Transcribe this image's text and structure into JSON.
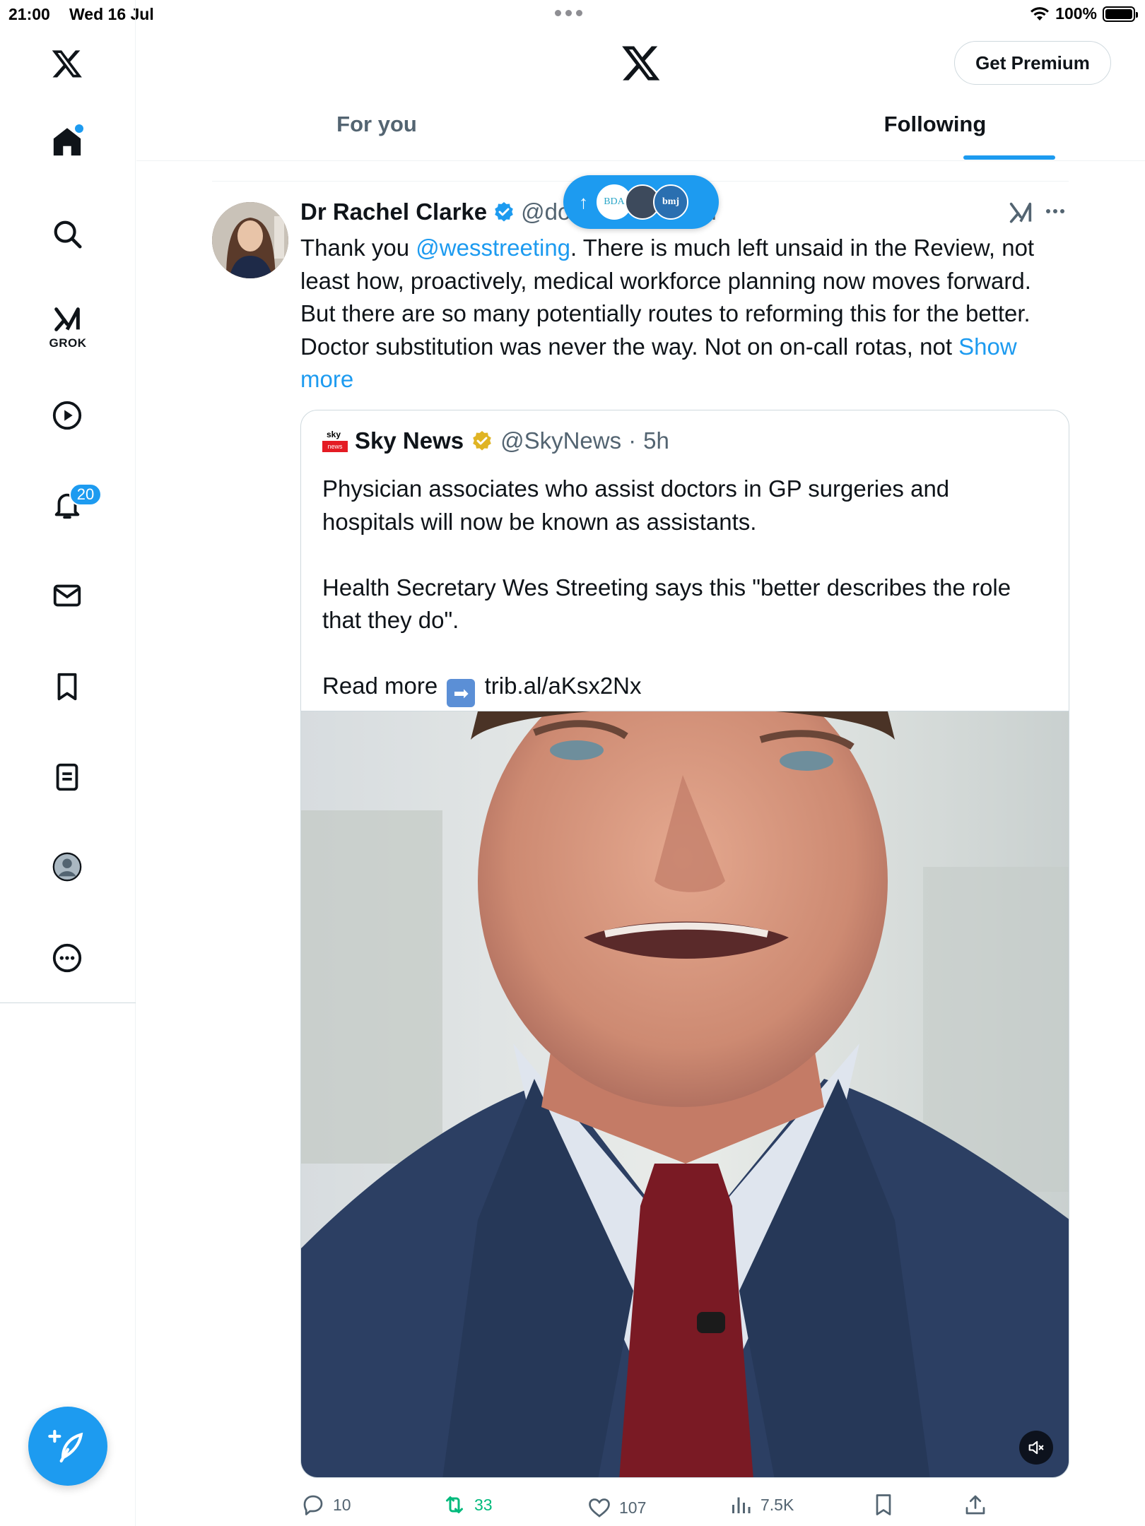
{
  "status_bar": {
    "time": "21:00",
    "date": "Wed 16 Jul",
    "battery": "100%",
    "battery_level": 1.0
  },
  "sidebar": {
    "items": [
      {
        "name": "x-logo-icon"
      },
      {
        "name": "home-icon"
      },
      {
        "name": "search-icon"
      },
      {
        "name": "grok-icon",
        "label": "GROK"
      },
      {
        "name": "video-icon"
      },
      {
        "name": "notifications-icon",
        "badge": "20"
      },
      {
        "name": "messages-icon"
      },
      {
        "name": "bookmarks-icon"
      },
      {
        "name": "lists-icon"
      },
      {
        "name": "profile-icon"
      },
      {
        "name": "more-icon"
      }
    ],
    "compose": "compose-icon"
  },
  "header": {
    "premium_label": "Get Premium",
    "tabs": [
      {
        "label": "For you",
        "active": false
      },
      {
        "label": "Following",
        "active": true
      }
    ]
  },
  "new_posts_pill": {
    "avatars": [
      "BDA",
      "",
      "bmj"
    ]
  },
  "tweet": {
    "name": "Dr Rachel Clarke",
    "handle": "@do",
    "handle_tail": "n",
    "text_before": "Thank you ",
    "mention": "@wesstreeting",
    "text_after": ". There is much left unsaid in the Review, not least how, proactively, medical workforce planning now moves forward. But there are so many potentially routes to reforming this for the better. Doctor substitution was never the way. Not on on-call rotas, not ",
    "show_more": "Show more",
    "quote": {
      "logo_top": "sky",
      "logo_bottom": "news",
      "name": "Sky News",
      "handle": "@SkyNews",
      "sep": "·",
      "time": "5h",
      "paragraph1": "Physician associates who assist doctors in GP surgeries and hospitals will now be known as assistants.",
      "paragraph2": "Health Secretary Wes Streeting says this \"better describes the role that they do\".",
      "read_more": "Read more",
      "link": "trib.al/aKsx2Nx"
    },
    "actions": {
      "replies": "10",
      "reposts": "33",
      "likes": "107",
      "views": "7.5K"
    }
  },
  "colors": {
    "accent": "#1d9bf0",
    "repost": "#00ba7c",
    "text": "#0f1419",
    "muted": "#536471",
    "gold_verified": "#e0b424"
  }
}
